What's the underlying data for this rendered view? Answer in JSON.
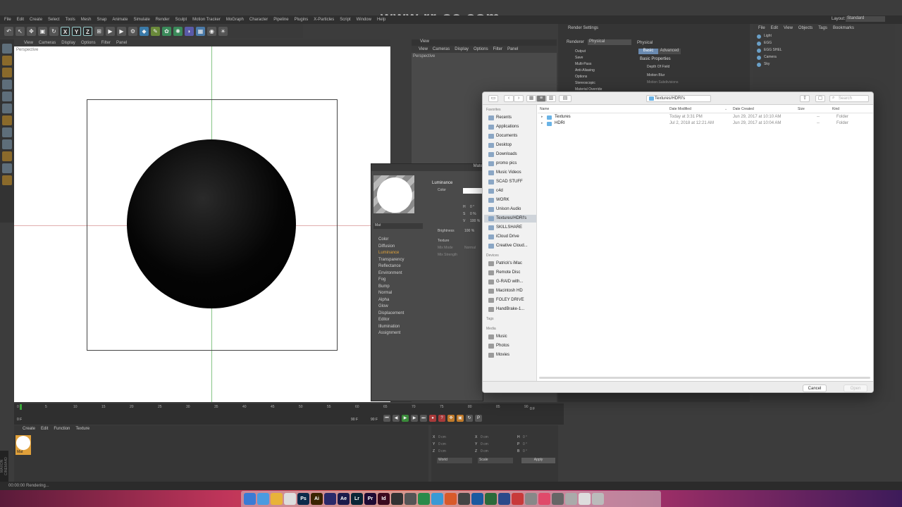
{
  "watermark": "www.rr-sc.com",
  "c4d": {
    "menu": [
      "File",
      "Edit",
      "Create",
      "Select",
      "Tools",
      "Mesh",
      "Snap",
      "Animate",
      "Simulate",
      "Render",
      "Sculpt",
      "Motion Tracker",
      "MoGraph",
      "Character",
      "Pipeline",
      "Plugins",
      "X-Particles",
      "Script",
      "Window",
      "Help"
    ],
    "layout_label": "Layout:",
    "layout_value": "Standard",
    "axis_buttons": [
      "X",
      "Y",
      "Z"
    ],
    "viewport_menu": [
      "View",
      "Cameras",
      "Display",
      "Options",
      "Filter",
      "Panel"
    ],
    "viewport_label": "Perspective",
    "view2_title": "View",
    "view2_menu": [
      "View",
      "Cameras",
      "Display",
      "Options",
      "Filter",
      "Panel"
    ],
    "view2_label": "Perspective",
    "render_settings": {
      "title": "Render Settings",
      "renderer_label": "Renderer",
      "renderer_value": "Physical",
      "items": [
        "Output",
        "Save",
        "Multi-Pass",
        "Anti-Aliasing",
        "Options",
        "Stereoscopic",
        "Material Override"
      ],
      "panel_title": "Physical",
      "tabs": [
        "Basic",
        "Advanced"
      ],
      "section": "Basic Properties",
      "props": [
        "Depth Of Field",
        "Motion Blur",
        "Motion Subdivisions"
      ]
    },
    "object_manager": {
      "menu": [
        "File",
        "Edit",
        "View",
        "Objects",
        "Tags",
        "Bookmarks"
      ],
      "objects": [
        "Light",
        "EGG",
        "EGG SHEL",
        "Camera",
        "Sky"
      ]
    },
    "timeline": {
      "ticks": [
        "0",
        "5",
        "10",
        "15",
        "20",
        "25",
        "30",
        "35",
        "40",
        "45",
        "50",
        "55",
        "60",
        "65",
        "70",
        "75",
        "80",
        "85",
        "90"
      ],
      "start": "0 F",
      "end": "90 F",
      "end2": "90 F",
      "current": "0 F"
    },
    "material_manager": {
      "menu": [
        "Create",
        "Edit",
        "Function",
        "Texture"
      ],
      "material_name": "Mat"
    },
    "coords": {
      "rows": [
        {
          "a": "X",
          "av": "0 cm",
          "b": "X",
          "bv": "0 cm",
          "c": "H",
          "cv": "0 °"
        },
        {
          "a": "Y",
          "av": "0 cm",
          "b": "Y",
          "bv": "0 cm",
          "c": "P",
          "cv": "0 °"
        },
        {
          "a": "Z",
          "av": "0 cm",
          "b": "Z",
          "bv": "0 cm",
          "c": "B",
          "cv": "0 °"
        }
      ],
      "mode1": "World",
      "mode2": "Scale",
      "apply": "Apply"
    },
    "status": "00:00:00 Rendering...",
    "brand": "MAXON CINEMA4D"
  },
  "material_editor": {
    "title": "Mate",
    "name": "Mat",
    "channels": [
      "Color",
      "Diffusion",
      "Luminance",
      "Transparency",
      "Reflectance",
      "Environment",
      "Fog",
      "Bump",
      "Normal",
      "Alpha",
      "Glow",
      "Displacement",
      "Editor",
      "Illumination",
      "Assignment"
    ],
    "selected_channel": "Luminance",
    "panel_title": "Luminance",
    "color_label": "Color",
    "hsv": [
      {
        "k": "H",
        "v": "0 °"
      },
      {
        "k": "S",
        "v": "0 %"
      },
      {
        "k": "V",
        "v": "100 %"
      }
    ],
    "brightness_label": "Brightness",
    "brightness_value": "100 %",
    "texture_label": "Texture",
    "mix_mode_label": "Mix Mode",
    "mix_mode_value": "Normal",
    "mix_strength_label": "Mix Strength"
  },
  "finder": {
    "path": "Textures/HDRI's",
    "search_placeholder": "Search",
    "sidebar": {
      "favorites_head": "Favorites",
      "favorites": [
        "Recents",
        "Applications",
        "Documents",
        "Desktop",
        "Downloads",
        "promo pics",
        "Music Videos",
        "SCAD STUFF",
        "c4d",
        "WORK",
        "Unison Audio",
        "Textures/HDRI's",
        "SKILLSHARE",
        "iCloud Drive",
        "Creative Cloud..."
      ],
      "selected": "Textures/HDRI's",
      "devices_head": "Devices",
      "devices": [
        "Patrick's iMac",
        "Remote Disc",
        "G-RAID with...",
        "Macintosh HD",
        "FOLEY DRIVE",
        "HandBrake-1..."
      ],
      "tags_head": "Tags",
      "media_head": "Media",
      "media": [
        "Music",
        "Photos",
        "Movies"
      ]
    },
    "columns": {
      "name": "Name",
      "modified": "Date Modified",
      "created": "Date Created",
      "size": "Size",
      "kind": "Kind"
    },
    "rows": [
      {
        "name": "Textures",
        "modified": "Today at 3:31 PM",
        "created": "Jun 29, 2017 at 10:10 AM",
        "size": "--",
        "kind": "Folder"
      },
      {
        "name": "HDRI",
        "modified": "Jul 2, 2018 at 12:21 AM",
        "created": "Jun 29, 2017 at 10:04 AM",
        "size": "--",
        "kind": "Folder"
      }
    ],
    "cancel": "Cancel",
    "open": "Open"
  },
  "dock": {
    "apps": [
      {
        "label": "",
        "color": "#3a7bd5"
      },
      {
        "label": "",
        "color": "#4a9be0"
      },
      {
        "label": "",
        "color": "#e8b33a"
      },
      {
        "label": "",
        "color": "#dddddd"
      },
      {
        "label": "Ps",
        "color": "#0c2a4a"
      },
      {
        "label": "Ai",
        "color": "#3a2300"
      },
      {
        "label": "",
        "color": "#2a2a6a"
      },
      {
        "label": "Ae",
        "color": "#1b1b4a"
      },
      {
        "label": "Lr",
        "color": "#0a2535"
      },
      {
        "label": "Pr",
        "color": "#1e0a33"
      },
      {
        "label": "Id",
        "color": "#3a0a1e"
      },
      {
        "label": "",
        "color": "#333"
      },
      {
        "label": "",
        "color": "#555"
      },
      {
        "label": "",
        "color": "#2a8a4a"
      },
      {
        "label": "",
        "color": "#3a9ad5"
      },
      {
        "label": "",
        "color": "#d85a2a"
      },
      {
        "label": "",
        "color": "#444"
      },
      {
        "label": "",
        "color": "#1a5aa0"
      },
      {
        "label": "",
        "color": "#2a6a3a"
      },
      {
        "label": "",
        "color": "#2a4a8a"
      },
      {
        "label": "",
        "color": "#c83a3a"
      },
      {
        "label": "",
        "color": "#888"
      },
      {
        "label": "",
        "color": "#e04a6a"
      },
      {
        "label": "",
        "color": "#666"
      },
      {
        "label": "",
        "color": "#aaa"
      },
      {
        "label": "",
        "color": "#ddd"
      },
      {
        "label": "",
        "color": "#bbb"
      }
    ]
  }
}
